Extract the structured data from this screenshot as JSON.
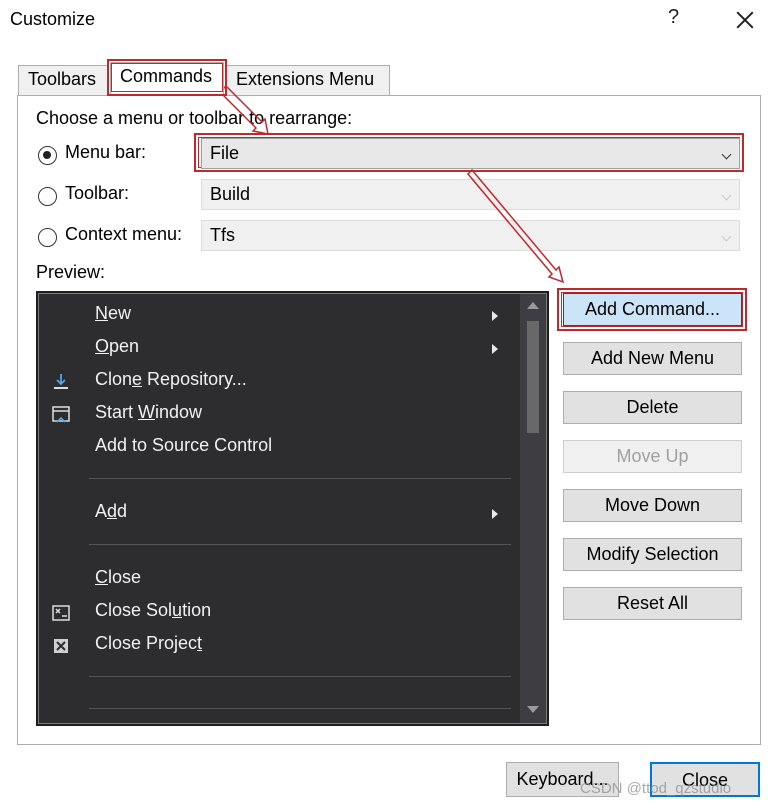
{
  "window": {
    "title": "Customize",
    "help_label": "?"
  },
  "tabs": [
    {
      "label": "Toolbars"
    },
    {
      "label": "Commands"
    },
    {
      "label": "Extensions Menu"
    }
  ],
  "choose_label": "Choose a menu or toolbar to rearrange:",
  "options": {
    "menu_bar": {
      "label": "Menu bar:",
      "value": "File",
      "selected": true
    },
    "toolbar": {
      "label": "Toolbar:",
      "value": "Build",
      "selected": false
    },
    "context_menu": {
      "label": "Context menu:",
      "value": "Tfs",
      "selected": false
    }
  },
  "preview_label": "Preview:",
  "preview_items": [
    {
      "pre": "",
      "u": "N",
      "post": "ew",
      "icon": "",
      "submenu": true
    },
    {
      "pre": "",
      "u": "O",
      "post": "pen",
      "icon": "",
      "submenu": true
    },
    {
      "pre": "Clon",
      "u": "e",
      "post": " Repository...",
      "icon": "download-icon",
      "submenu": false
    },
    {
      "pre": "Start ",
      "u": "W",
      "post": "indow",
      "icon": "start-window-icon",
      "submenu": false
    },
    {
      "pre": "Add to Source Control",
      "u": "",
      "post": "",
      "icon": "",
      "submenu": false
    },
    {
      "pre": "A",
      "u": "d",
      "post": "d",
      "icon": "",
      "submenu": true
    },
    {
      "pre": "",
      "u": "C",
      "post": "lose",
      "icon": "",
      "submenu": false
    },
    {
      "pre": "Close Sol",
      "u": "u",
      "post": "tion",
      "icon": "close-solution-icon",
      "submenu": false
    },
    {
      "pre": "Close Projec",
      "u": "t",
      "post": "",
      "icon": "close-project-icon",
      "submenu": false
    }
  ],
  "buttons": {
    "add_command": "Add Command...",
    "add_new_menu": "Add New Menu",
    "delete": "Delete",
    "move_up": "Move Up",
    "move_down": "Move Down",
    "modify_selection": "Modify Selection",
    "reset_all": "Reset All"
  },
  "footer": {
    "keyboard": "Keyboard...",
    "close": "Close"
  },
  "watermark": "CSDN @ttod_qzstudio",
  "colors": {
    "highlight": "#c0282d",
    "primary_button": "#cce4f7",
    "preview_bg": "#2d2d30"
  }
}
